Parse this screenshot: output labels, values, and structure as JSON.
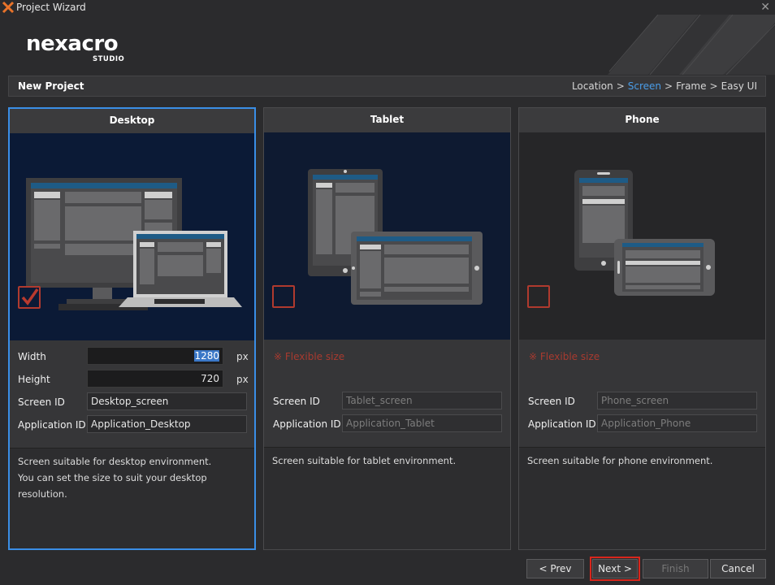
{
  "window": {
    "title": "Project Wizard"
  },
  "logo": {
    "brand": "nexacro",
    "sub": "STUDIO"
  },
  "stepbar": {
    "title": "New Project",
    "steps": [
      "Location",
      "Screen",
      "Frame",
      "Easy UI"
    ],
    "current_step": "Screen",
    "separator": ">"
  },
  "panels": {
    "desktop": {
      "title": "Desktop",
      "checked": true,
      "width_label": "Width",
      "width_value": "1280",
      "height_label": "Height",
      "height_value": "720",
      "unit": "px",
      "screen_id_label": "Screen ID",
      "screen_id_value": "Desktop_screen",
      "app_id_label": "Application ID",
      "app_id_value": "Application_Desktop",
      "desc_line1": "Screen suitable for desktop environment.",
      "desc_line2": "You can set the size to suit your desktop resolution."
    },
    "tablet": {
      "title": "Tablet",
      "checked": false,
      "flexible": "※ Flexible size",
      "screen_id_label": "Screen ID",
      "screen_id_value": "Tablet_screen",
      "app_id_label": "Application ID",
      "app_id_value": "Application_Tablet",
      "desc_line1": "Screen suitable for tablet environment."
    },
    "phone": {
      "title": "Phone",
      "checked": false,
      "flexible": "※ Flexible size",
      "screen_id_label": "Screen ID",
      "screen_id_value": "Phone_screen",
      "app_id_label": "Application ID",
      "app_id_value": "Application_Phone",
      "desc_line1": "Screen suitable for phone environment."
    }
  },
  "buttons": {
    "prev": "< Prev",
    "next": "Next >",
    "finish": "Finish",
    "cancel": "Cancel"
  },
  "colors": {
    "accent": "#3a8ee6",
    "check": "#b03a2e",
    "highlight": "#d9261c",
    "navy": "#0f1b33"
  }
}
